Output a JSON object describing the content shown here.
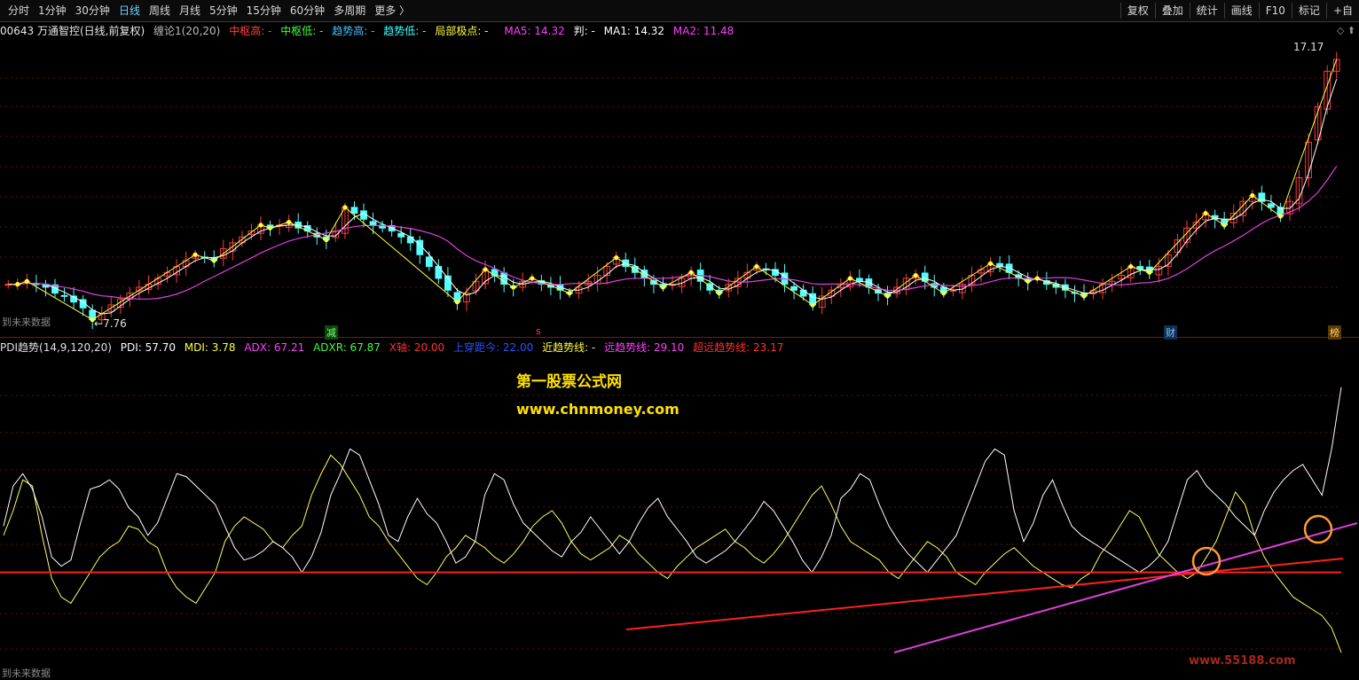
{
  "toolbar": {
    "periods": [
      "分时",
      "1分钟",
      "30分钟",
      "日线",
      "周线",
      "月线",
      "5分钟",
      "15分钟",
      "60分钟",
      "多周期",
      "更多 〉"
    ],
    "active_period": "日线",
    "tools": [
      "复权",
      "叠加",
      "统计",
      "画线",
      "F10",
      "标记",
      "+自"
    ]
  },
  "main_info": {
    "stock": "00643 万通智控(日线,前复权)",
    "indicator": "缠论1(20,20)",
    "zsg": "中枢高: -",
    "zsd": "中枢低: -",
    "qsg": "趋势高: -",
    "qsd": "趋势低: -",
    "jbjd": "局部极点: -",
    "ma5": "MA5: 14.32",
    "pan": "判: -",
    "ma1": "MA1: 14.32",
    "ma2": "MA2: 11.48",
    "price_high": "17.17",
    "price_low": "7.76",
    "future_label": "到未来数据",
    "marker_jian": "减",
    "marker_s": "s",
    "marker_cai": "财",
    "marker_bang": "榜"
  },
  "sub_info": {
    "name": "PDI趋势(14,9,120,20)",
    "pdi": "PDI: 57.70",
    "mdi": "MDI: 3.78",
    "adx": "ADX: 67.21",
    "adxr": "ADXR: 67.87",
    "xaxis": "X轴: 20.00",
    "shang": "上穿距今: 22.00",
    "jin": "近趋势线: -",
    "yuan": "远趋势线: 29.10",
    "chao": "超远趋势线: 23.17",
    "future_label": "到未来数据"
  },
  "watermark": {
    "line1": "第一股票公式网",
    "line2": "www.chnmoney.com",
    "corner": "www.55188.com"
  },
  "colors": {
    "up": "#ff3b3b",
    "down": "#54ffff",
    "ma1": "#ffffff",
    "ma2": "#e040e0",
    "zigzag": "#ffff40",
    "pdi": "#ffffff",
    "mdi": "#ffff60",
    "xaxis": "#ff2020",
    "trend_far": "#ff2020",
    "trend_near": "#e040e0",
    "circle": "#ff9a30"
  },
  "chart_data": {
    "type": "line",
    "price_range": [
      7.76,
      17.17
    ],
    "candles_close": [
      9.0,
      9.0,
      9.1,
      9.0,
      8.9,
      8.7,
      8.6,
      8.4,
      8.2,
      7.8,
      8.0,
      8.3,
      8.5,
      8.7,
      8.9,
      9.0,
      9.2,
      9.4,
      9.6,
      9.8,
      10.0,
      9.9,
      9.8,
      10.2,
      10.4,
      10.6,
      10.8,
      11.0,
      10.9,
      11.0,
      11.1,
      10.9,
      10.8,
      10.6,
      10.5,
      10.8,
      11.6,
      11.4,
      11.2,
      11.0,
      10.9,
      10.8,
      10.6,
      10.4,
      10.0,
      9.6,
      9.2,
      8.8,
      8.4,
      8.7,
      9.1,
      9.5,
      9.3,
      9.0,
      8.9,
      9.1,
      9.2,
      9.0,
      8.9,
      8.8,
      8.7,
      8.9,
      9.1,
      9.3,
      9.6,
      9.9,
      9.6,
      9.4,
      9.2,
      9.0,
      8.9,
      9.0,
      9.2,
      9.4,
      9.1,
      8.8,
      8.7,
      9.0,
      9.2,
      9.4,
      9.6,
      9.5,
      9.3,
      9.0,
      8.8,
      8.6,
      8.3,
      8.6,
      8.8,
      9.0,
      9.2,
      9.1,
      8.9,
      8.7,
      8.6,
      8.9,
      9.2,
      9.3,
      9.1,
      8.9,
      8.7,
      8.8,
      9.0,
      9.3,
      9.5,
      9.7,
      9.6,
      9.4,
      9.2,
      9.1,
      9.2,
      9.0,
      8.9,
      8.8,
      8.7,
      8.6,
      8.8,
      9.0,
      9.1,
      9.3,
      9.6,
      9.5,
      9.4,
      9.6,
      10.0,
      10.5,
      10.9,
      11.1,
      11.4,
      11.2,
      11.0,
      11.4,
      11.8,
      12.0,
      11.8,
      11.6,
      11.3,
      11.8,
      12.6,
      13.8,
      15.0,
      16.2,
      16.6
    ],
    "pdi": [
      45,
      58,
      62,
      57,
      48,
      35,
      32,
      34,
      46,
      57,
      58,
      60,
      57,
      51,
      48,
      42,
      46,
      54,
      62,
      61,
      58,
      55,
      52,
      45,
      38,
      34,
      35,
      37,
      40,
      38,
      35,
      30,
      35,
      43,
      55,
      62,
      70,
      68,
      60,
      52,
      42,
      40,
      48,
      54,
      49,
      46,
      40,
      33,
      35,
      40,
      55,
      62,
      60,
      52,
      46,
      43,
      40,
      37,
      35,
      40,
      43,
      48,
      44,
      40,
      36,
      40,
      46,
      51,
      54,
      48,
      44,
      40,
      35,
      33,
      35,
      37,
      40,
      44,
      48,
      53,
      50,
      45,
      40,
      34,
      30,
      35,
      42,
      54,
      57,
      62,
      60,
      52,
      45,
      40,
      36,
      33,
      30,
      34,
      38,
      42,
      50,
      58,
      66,
      70,
      68,
      50,
      40,
      46,
      55,
      60,
      52,
      45,
      42,
      40,
      38,
      36,
      34,
      32,
      30,
      32,
      35,
      40,
      50,
      60,
      63,
      58,
      55,
      52,
      48,
      45,
      42,
      50,
      56,
      60,
      63,
      65,
      60,
      55,
      70,
      90
    ],
    "mdi": [
      42,
      50,
      60,
      58,
      42,
      28,
      22,
      20,
      25,
      30,
      35,
      38,
      40,
      45,
      44,
      40,
      38,
      30,
      25,
      22,
      20,
      25,
      30,
      40,
      45,
      48,
      46,
      44,
      40,
      38,
      42,
      45,
      55,
      62,
      68,
      65,
      60,
      55,
      48,
      45,
      40,
      36,
      32,
      28,
      26,
      30,
      35,
      38,
      42,
      40,
      38,
      35,
      33,
      36,
      40,
      45,
      48,
      50,
      46,
      40,
      36,
      34,
      36,
      38,
      42,
      40,
      36,
      33,
      30,
      28,
      32,
      35,
      38,
      40,
      42,
      44,
      40,
      38,
      35,
      33,
      36,
      40,
      45,
      50,
      55,
      58,
      52,
      45,
      40,
      38,
      36,
      34,
      30,
      28,
      32,
      36,
      40,
      38,
      35,
      30,
      28,
      26,
      30,
      33,
      36,
      38,
      35,
      32,
      30,
      28,
      26,
      25,
      28,
      30,
      36,
      40,
      45,
      50,
      48,
      42,
      36,
      33,
      30,
      28,
      30,
      35,
      40,
      48,
      56,
      52,
      42,
      35,
      30,
      26,
      22,
      20,
      18,
      16,
      12,
      4
    ]
  }
}
